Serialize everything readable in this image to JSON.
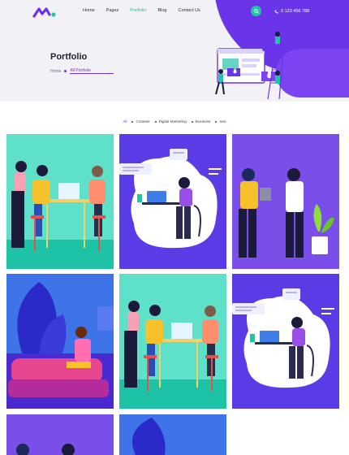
{
  "nav": {
    "items": [
      {
        "label": "Home",
        "active": false
      },
      {
        "label": "Pages",
        "active": false
      },
      {
        "label": "Portfolio",
        "active": true
      },
      {
        "label": "Blog",
        "active": false
      },
      {
        "label": "Contact Us",
        "active": false
      }
    ],
    "phone": "0 123 456 788",
    "search_icon": "search-icon",
    "phone_icon": "phone-icon"
  },
  "hero": {
    "title": "Portfolio",
    "breadcrumb": {
      "home": "Home",
      "current": "All Portfolio"
    }
  },
  "filters": [
    {
      "label": "All",
      "active": true
    },
    {
      "label": "Creative",
      "active": false
    },
    {
      "label": "Digital Marketing",
      "active": false
    },
    {
      "label": "Business",
      "active": false
    },
    {
      "label": "Seo",
      "active": false
    }
  ],
  "colors": {
    "accent": "#6a35e8",
    "teal": "#23c3a6",
    "hero_bg": "#f1f1f6",
    "card_teal": "#5fe0c9",
    "card_purple": "#5a3be6",
    "card_violet": "#7a4ee8",
    "card_blue": "#3f74e8"
  },
  "portfolio": [
    {
      "scene": "team-meeting-illustration",
      "bg": "#5fe0c9"
    },
    {
      "scene": "laptop-desk-illustration",
      "bg": "#5a3be6"
    },
    {
      "scene": "business-handshake-illustration",
      "bg": "#7a4ee8"
    },
    {
      "scene": "sofa-phone-illustration",
      "bg": "#3f74e8"
    },
    {
      "scene": "team-meeting-illustration",
      "bg": "#5fe0c9"
    },
    {
      "scene": "laptop-desk-illustration",
      "bg": "#5a3be6"
    },
    {
      "scene": "business-handshake-illustration",
      "bg": "#7a4ee8"
    },
    {
      "scene": "sofa-phone-illustration",
      "bg": "#3f74e8"
    }
  ]
}
